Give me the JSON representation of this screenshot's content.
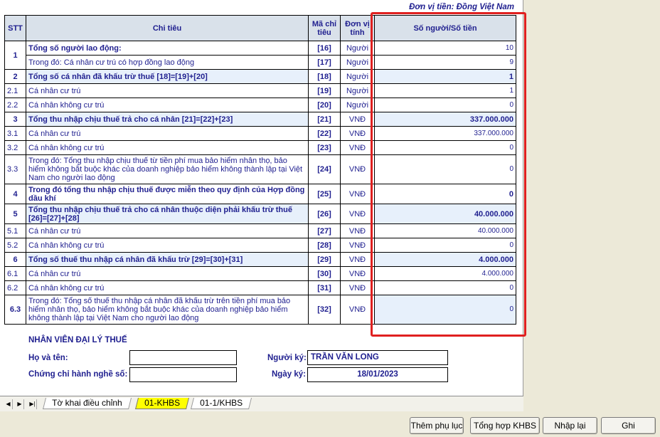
{
  "header": {
    "unit_note": "Đơn vị tiền: Đồng Việt Nam",
    "col_stt": "STT",
    "col_name": "Chi tiêu",
    "col_code": "Mã chỉ tiêu",
    "col_unit": "Đơn vị tính",
    "col_value": "Số người/Số tiền"
  },
  "rows": [
    {
      "stt": "",
      "name": "Tổng số người lao động:",
      "code": "[16]",
      "unit": "Người",
      "value": "10"
    },
    {
      "stt": "",
      "name": "Trong đó: Cá nhân cư trú có hợp đồng lao động",
      "code": "[17]",
      "unit": "Người",
      "value": "9"
    },
    {
      "stt": "2",
      "name": "Tổng số cá nhân đã khấu trừ thuế [18]=[19]+[20]",
      "code": "[18]",
      "unit": "Người",
      "value": "1"
    },
    {
      "stt": "2.1",
      "name": "Cá nhân cư trú",
      "code": "[19]",
      "unit": "Người",
      "value": "1"
    },
    {
      "stt": "2.2",
      "name": "Cá nhân không cư trú",
      "code": "[20]",
      "unit": "Người",
      "value": "0"
    },
    {
      "stt": "3",
      "name": "Tổng thu nhập chịu thuế trả cho cá nhân [21]=[22]+[23]",
      "code": "[21]",
      "unit": "VNĐ",
      "value": "337.000.000"
    },
    {
      "stt": "3.1",
      "name": "Cá nhân cư trú",
      "code": "[22]",
      "unit": "VNĐ",
      "value": "337.000.000"
    },
    {
      "stt": "3.2",
      "name": "Cá nhân không cư trú",
      "code": "[23]",
      "unit": "VNĐ",
      "value": "0"
    },
    {
      "stt": "3.3",
      "name": "Trong đó: Tổng thu nhập chịu thuế từ tiền phí mua bảo hiểm nhân thọ, bảo hiểm không bắt buộc khác của doanh nghiệp bảo hiểm không thành lập tại Việt Nam cho người lao động",
      "code": "[24]",
      "unit": "VNĐ",
      "value": "0"
    },
    {
      "stt": "4",
      "name": "Trong đó tổng thu nhập chịu thuế được miễn theo quy định của Hợp đồng dầu khí",
      "code": "[25]",
      "unit": "VNĐ",
      "value": "0"
    },
    {
      "stt": "5",
      "name": "Tổng  thu nhập chịu thuế trả cho cá nhân thuộc diện phải khấu trừ thuế [26]=[27]+[28]",
      "code": "[26]",
      "unit": "VNĐ",
      "value": "40.000.000"
    },
    {
      "stt": "5.1",
      "name": "Cá nhân cư trú",
      "code": "[27]",
      "unit": "VNĐ",
      "value": "40.000.000"
    },
    {
      "stt": "5.2",
      "name": "Cá nhân không cư trú",
      "code": "[28]",
      "unit": "VNĐ",
      "value": "0"
    },
    {
      "stt": "6",
      "name": "Tổng số thuế thu nhập cá nhân đã khấu trừ [29]=[30]+[31]",
      "code": "[29]",
      "unit": "VNĐ",
      "value": "4.000.000"
    },
    {
      "stt": "6.1",
      "name": "Cá nhân cư trú",
      "code": "[30]",
      "unit": "VNĐ",
      "value": "4.000.000"
    },
    {
      "stt": "6.2",
      "name": "Cá nhân không cư trú",
      "code": "[31]",
      "unit": "VNĐ",
      "value": "0"
    },
    {
      "stt": "6.3",
      "name": "Trong đó: Tổng số thuế thu nhập cá nhân đã khấu trừ trên tiền phí mua bảo hiểm nhân thọ, bảo hiểm không bắt buộc khác của doanh nghiệp bảo hiểm không thành lập tại Việt Nam cho người lao động",
      "code": "[32]",
      "unit": "VNĐ",
      "value": "0"
    }
  ],
  "row1_stt": "1",
  "agent": {
    "title": "NHÂN VIÊN ĐẠI LÝ THUẾ",
    "name_label": "Họ và tên:",
    "name_value": "",
    "cert_label": "Chứng chỉ hành nghề số:",
    "cert_value": "",
    "signer_label": "Người ký:",
    "signer_value": "TRẦN VĂN LONG",
    "date_label": "Ngày ký:",
    "date_value": "18/01/2023"
  },
  "tabs": [
    {
      "label": "Tờ khai điều chỉnh",
      "active": false
    },
    {
      "label": "01-KHBS",
      "active": true
    },
    {
      "label": "01-1/KHBS",
      "active": false
    }
  ],
  "buttons": {
    "add_appendix": "Thêm phụ lục",
    "summary": "Tổng hợp KHBS",
    "reset": "Nhập lại",
    "save": "Ghi"
  },
  "colors": {
    "highlight_box": "#e02020",
    "active_tab": "#ffff00",
    "text": "#1f1f8f"
  }
}
